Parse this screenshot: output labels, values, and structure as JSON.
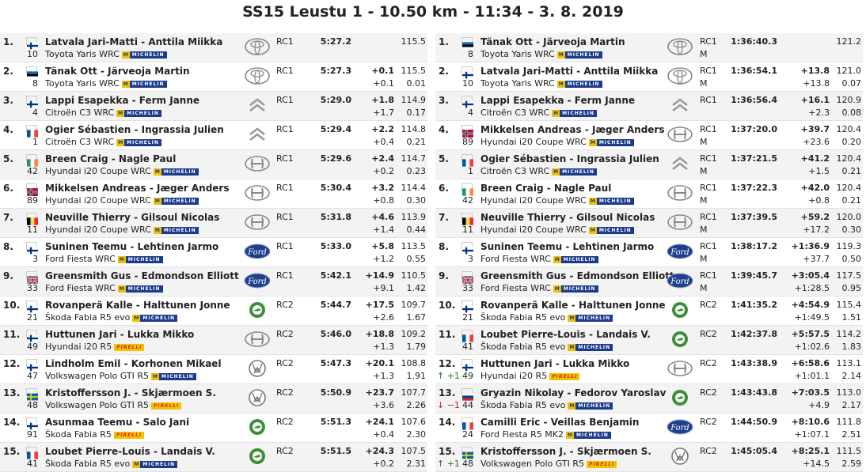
{
  "title": "SS15 Leustu 1 - 10.50 km - 11:34 - 3. 8. 2019",
  "colors": {
    "green": "#1a7a1a",
    "red": "#c42020",
    "michelin_blue": "#1b3c8c",
    "michelin_yellow": "#f3c000",
    "pirelli_yellow": "#f1c400"
  },
  "tyres": {
    "michelin": "MICHELIN",
    "michelin_mark": "M",
    "pirelli": "PIRELLI"
  },
  "stage": [
    {
      "pos": "1.",
      "flag": "fin",
      "crew": "Latvala Jari-Matti - Anttila Miikka",
      "num": "10",
      "car": "Toyota Yaris WRC",
      "tyre": "michelin",
      "logo": "toyota-logo",
      "cls": "RC1",
      "time": "5:27.2",
      "gap": "",
      "diff": "",
      "speed": "115.5",
      "speed2": ""
    },
    {
      "pos": "2.",
      "flag": "est",
      "crew": "Tänak Ott - Järveoja Martin",
      "num": "8",
      "car": "Toyota Yaris WRC",
      "tyre": "michelin",
      "logo": "toyota-logo",
      "cls": "RC1",
      "time": "5:27.3",
      "gap": "+0.1",
      "diff": "+0.1",
      "speed": "115.5",
      "speed2": "0.01"
    },
    {
      "pos": "3.",
      "flag": "fin",
      "crew": "Lappi Esapekka - Ferm Janne",
      "num": "4",
      "car": "Citroën C3 WRC",
      "tyre": "michelin",
      "logo": "citroen-logo",
      "cls": "RC1",
      "time": "5:29.0",
      "gap": "+1.8",
      "diff": "+1.7",
      "speed": "114.9",
      "speed2": "0.17"
    },
    {
      "pos": "4.",
      "flag": "fra",
      "crew": "Ogier Sébastien - Ingrassia Julien",
      "num": "1",
      "car": "Citroën C3 WRC",
      "tyre": "michelin",
      "logo": "citroen-logo",
      "cls": "RC1",
      "time": "5:29.4",
      "gap": "+2.2",
      "diff": "+0.4",
      "speed": "114.8",
      "speed2": "0.21"
    },
    {
      "pos": "5.",
      "flag": "irl",
      "crew": "Breen Craig - Nagle Paul",
      "num": "42",
      "car": "Hyundai i20 Coupe WRC",
      "tyre": "michelin",
      "logo": "hyundai-logo",
      "cls": "RC1",
      "time": "5:29.6",
      "gap": "+2.4",
      "diff": "+0.2",
      "speed": "114.7",
      "speed2": "0.23"
    },
    {
      "pos": "6.",
      "flag": "nor",
      "crew": "Mikkelsen Andreas - Jæger Anders",
      "num": "89",
      "car": "Hyundai i20 Coupe WRC",
      "tyre": "michelin",
      "logo": "hyundai-logo",
      "cls": "RC1",
      "time": "5:30.4",
      "gap": "+3.2",
      "diff": "+0.8",
      "speed": "114.4",
      "speed2": "0.30"
    },
    {
      "pos": "7.",
      "flag": "bel",
      "crew": "Neuville Thierry - Gilsoul Nicolas",
      "num": "11",
      "car": "Hyundai i20 Coupe WRC",
      "tyre": "michelin",
      "logo": "hyundai-logo",
      "cls": "RC1",
      "time": "5:31.8",
      "gap": "+4.6",
      "diff": "+1.4",
      "speed": "113.9",
      "speed2": "0.44"
    },
    {
      "pos": "8.",
      "flag": "fin",
      "crew": "Suninen Teemu - Lehtinen Jarmo",
      "num": "3",
      "car": "Ford Fiesta WRC",
      "tyre": "michelin",
      "logo": "ford-logo",
      "cls": "RC1",
      "time": "5:33.0",
      "gap": "+5.8",
      "diff": "+1.2",
      "speed": "113.5",
      "speed2": "0.55"
    },
    {
      "pos": "9.",
      "flag": "gbr",
      "crew": "Greensmith Gus - Edmondson Elliott",
      "num": "33",
      "car": "Ford Fiesta WRC",
      "tyre": "michelin",
      "logo": "ford-logo",
      "cls": "RC1",
      "time": "5:42.1",
      "gap": "+14.9",
      "diff": "+9.1",
      "speed": "110.5",
      "speed2": "1.42"
    },
    {
      "pos": "10.",
      "flag": "fin",
      "crew": "Rovanperä Kalle - Halttunen Jonne",
      "num": "21",
      "car": "Škoda Fabia R5 evo",
      "tyre": "michelin",
      "logo": "skoda-logo",
      "cls": "RC2",
      "time": "5:44.7",
      "gap": "+17.5",
      "diff": "+2.6",
      "speed": "109.7",
      "speed2": "1.67"
    },
    {
      "pos": "11.",
      "flag": "fin",
      "crew": "Huttunen Jari - Lukka Mikko",
      "num": "49",
      "car": "Hyundai i20 R5",
      "tyre": "pirelli",
      "logo": "hyundai-logo",
      "cls": "RC2",
      "time": "5:46.0",
      "gap": "+18.8",
      "diff": "+1.3",
      "speed": "109.2",
      "speed2": "1.79"
    },
    {
      "pos": "12.",
      "flag": "fin",
      "crew": "Lindholm Emil - Korhonen Mikael",
      "num": "47",
      "car": "Volkswagen Polo GTI R5",
      "tyre": "michelin",
      "logo": "vw-logo",
      "cls": "RC2",
      "time": "5:47.3",
      "gap": "+20.1",
      "diff": "+1.3",
      "speed": "108.8",
      "speed2": "1.91"
    },
    {
      "pos": "13.",
      "flag": "swe",
      "crew": "Kristoffersson J. - Skjærmoen S.",
      "num": "48",
      "car": "Volkswagen Polo GTI R5",
      "tyre": "pirelli",
      "logo": "vw-logo",
      "cls": "RC2",
      "time": "5:50.9",
      "gap": "+23.7",
      "diff": "+3.6",
      "speed": "107.7",
      "speed2": "2.26"
    },
    {
      "pos": "14.",
      "flag": "fin",
      "crew": "Asunmaa Teemu - Salo Jani",
      "num": "91",
      "car": "Škoda Fabia R5",
      "tyre": "pirelli",
      "logo": "skoda-logo",
      "cls": "RC2",
      "time": "5:51.3",
      "gap": "+24.1",
      "diff": "+0.4",
      "speed": "107.6",
      "speed2": "2.30"
    },
    {
      "pos": "15.",
      "flag": "fra",
      "crew": "Loubet Pierre-Louis - Landais V.",
      "num": "41",
      "car": "Škoda Fabia R5 evo",
      "tyre": "michelin",
      "logo": "skoda-logo",
      "cls": "RC2",
      "time": "5:51.5",
      "gap": "+24.3",
      "diff": "+0.2",
      "speed": "107.5",
      "speed2": "2.31"
    }
  ],
  "overall": [
    {
      "pos": "1.",
      "chg": "",
      "flag": "est",
      "crew": "Tänak Ott - Järveoja Martin",
      "num": "8",
      "car": "Toyota Yaris WRC",
      "tyre": "michelin",
      "logo": "toyota-logo",
      "cls": "RC1",
      "cls2": "M",
      "time": "1:36:40.3",
      "gap": "",
      "diff": "",
      "speed": "121.2",
      "speed2": ""
    },
    {
      "pos": "2.",
      "chg": "",
      "flag": "fin",
      "crew": "Latvala Jari-Matti - Anttila Miikka",
      "num": "10",
      "car": "Toyota Yaris WRC",
      "tyre": "michelin",
      "logo": "toyota-logo",
      "cls": "RC1",
      "cls2": "M",
      "time": "1:36:54.1",
      "gap": "+13.8",
      "diff": "+13.8",
      "speed": "121.0",
      "speed2": "0.07"
    },
    {
      "pos": "3.",
      "chg": "",
      "flag": "fin",
      "crew": "Lappi Esapekka - Ferm Janne",
      "num": "4",
      "car": "Citroën C3 WRC",
      "tyre": "michelin",
      "logo": "citroen-logo",
      "cls": "RC1",
      "cls2": "",
      "time": "1:36:56.4",
      "gap": "+16.1",
      "diff": "+2.3",
      "speed": "120.9",
      "speed2": "0.08"
    },
    {
      "pos": "4.",
      "chg": "",
      "flag": "nor",
      "crew": "Mikkelsen Andreas - Jæger Anders",
      "num": "89",
      "car": "Hyundai i20 Coupe WRC",
      "tyre": "michelin",
      "logo": "hyundai-logo",
      "cls": "RC1",
      "cls2": "M",
      "time": "1:37:20.0",
      "gap": "+39.7",
      "diff": "+23.6",
      "speed": "120.4",
      "speed2": "0.20"
    },
    {
      "pos": "5.",
      "chg": "",
      "flag": "fra",
      "crew": "Ogier Sébastien - Ingrassia Julien",
      "num": "1",
      "car": "Citroën C3 WRC",
      "tyre": "michelin",
      "logo": "citroen-logo",
      "cls": "RC1",
      "cls2": "M",
      "time": "1:37:21.5",
      "gap": "+41.2",
      "diff": "+1.5",
      "speed": "120.4",
      "speed2": "0.21"
    },
    {
      "pos": "6.",
      "chg": "",
      "flag": "irl",
      "crew": "Breen Craig - Nagle Paul",
      "num": "42",
      "car": "Hyundai i20 Coupe WRC",
      "tyre": "michelin",
      "logo": "hyundai-logo",
      "cls": "RC1",
      "cls2": "M",
      "time": "1:37:22.3",
      "gap": "+42.0",
      "diff": "+0.8",
      "speed": "120.4",
      "speed2": "0.21"
    },
    {
      "pos": "7.",
      "chg": "",
      "flag": "bel",
      "crew": "Neuville Thierry - Gilsoul Nicolas",
      "num": "11",
      "car": "Hyundai i20 Coupe WRC",
      "tyre": "michelin",
      "logo": "hyundai-logo",
      "cls": "RC1",
      "cls2": "M",
      "time": "1:37:39.5",
      "gap": "+59.2",
      "diff": "+17.2",
      "speed": "120.0",
      "speed2": "0.30"
    },
    {
      "pos": "8.",
      "chg": "",
      "flag": "fin",
      "crew": "Suninen Teemu - Lehtinen Jarmo",
      "num": "3",
      "car": "Ford Fiesta WRC",
      "tyre": "michelin",
      "logo": "ford-logo",
      "cls": "RC1",
      "cls2": "M",
      "time": "1:38:17.2",
      "gap": "+1:36.9",
      "diff": "+37.7",
      "speed": "119.3",
      "speed2": "0.50"
    },
    {
      "pos": "9.",
      "chg": "",
      "flag": "gbr",
      "crew": "Greensmith Gus - Edmondson Elliott",
      "num": "33",
      "car": "Ford Fiesta WRC",
      "tyre": "michelin",
      "logo": "ford-logo",
      "cls": "RC1",
      "cls2": "M",
      "time": "1:39:45.7",
      "gap": "+3:05.4",
      "diff": "+1:28.5",
      "speed": "117.5",
      "speed2": "0.95"
    },
    {
      "pos": "10.",
      "chg": "",
      "flag": "fin",
      "crew": "Rovanperä Kalle - Halttunen Jonne",
      "num": "21",
      "car": "Škoda Fabia R5 evo",
      "tyre": "michelin",
      "logo": "skoda-logo",
      "cls": "RC2",
      "cls2": "",
      "time": "1:41:35.2",
      "gap": "+4:54.9",
      "diff": "+1:49.5",
      "speed": "115.4",
      "speed2": "1.51"
    },
    {
      "pos": "11.",
      "chg": "",
      "flag": "fra",
      "crew": "Loubet Pierre-Louis - Landais V.",
      "num": "41",
      "car": "Škoda Fabia R5 evo",
      "tyre": "michelin",
      "logo": "skoda-logo",
      "cls": "RC2",
      "cls2": "",
      "time": "1:42:37.8",
      "gap": "+5:57.5",
      "diff": "+1:02.6",
      "speed": "114.2",
      "speed2": "1.83"
    },
    {
      "pos": "12.",
      "chg": "↑ +1",
      "chgdir": "up",
      "flag": "fin",
      "crew": "Huttunen Jari - Lukka Mikko",
      "num": "49",
      "car": "Hyundai i20 R5",
      "tyre": "pirelli",
      "logo": "hyundai-logo",
      "cls": "RC2",
      "cls2": "",
      "time": "1:43:38.9",
      "gap": "+6:58.6",
      "diff": "+1:01.1",
      "speed": "113.1",
      "speed2": "2.14"
    },
    {
      "pos": "13.",
      "chg": "↓ −1",
      "chgdir": "down",
      "flag": "rus",
      "crew": "Gryazin Nikolay - Fedorov Yaroslav",
      "num": "44",
      "car": "Škoda Fabia R5 evo",
      "tyre": "michelin",
      "logo": "skoda-logo",
      "cls": "RC2",
      "cls2": "",
      "time": "1:43:43.8",
      "gap": "+7:03.5",
      "diff": "+4.9",
      "speed": "113.0",
      "speed2": "2.17"
    },
    {
      "pos": "14.",
      "chg": "",
      "flag": "fra",
      "crew": "Camilli Eric - Veillas Benjamin",
      "num": "24",
      "car": "Ford Fiesta R5 MK2",
      "tyre": "michelin",
      "logo": "ford-logo",
      "cls": "RC2",
      "cls2": "",
      "time": "1:44:50.9",
      "gap": "+8:10.6",
      "diff": "+1:07.1",
      "speed": "111.8",
      "speed2": "2.51"
    },
    {
      "pos": "15.",
      "chg": "↑ +1",
      "chgdir": "up",
      "flag": "swe",
      "crew": "Kristoffersson J. - Skjærmoen S.",
      "num": "48",
      "car": "Volkswagen Polo GTI R5",
      "tyre": "pirelli",
      "logo": "vw-logo",
      "cls": "RC2",
      "cls2": "",
      "time": "1:45:05.4",
      "gap": "+8:25.1",
      "diff": "+14.5",
      "speed": "111.5",
      "speed2": "2.59"
    }
  ]
}
